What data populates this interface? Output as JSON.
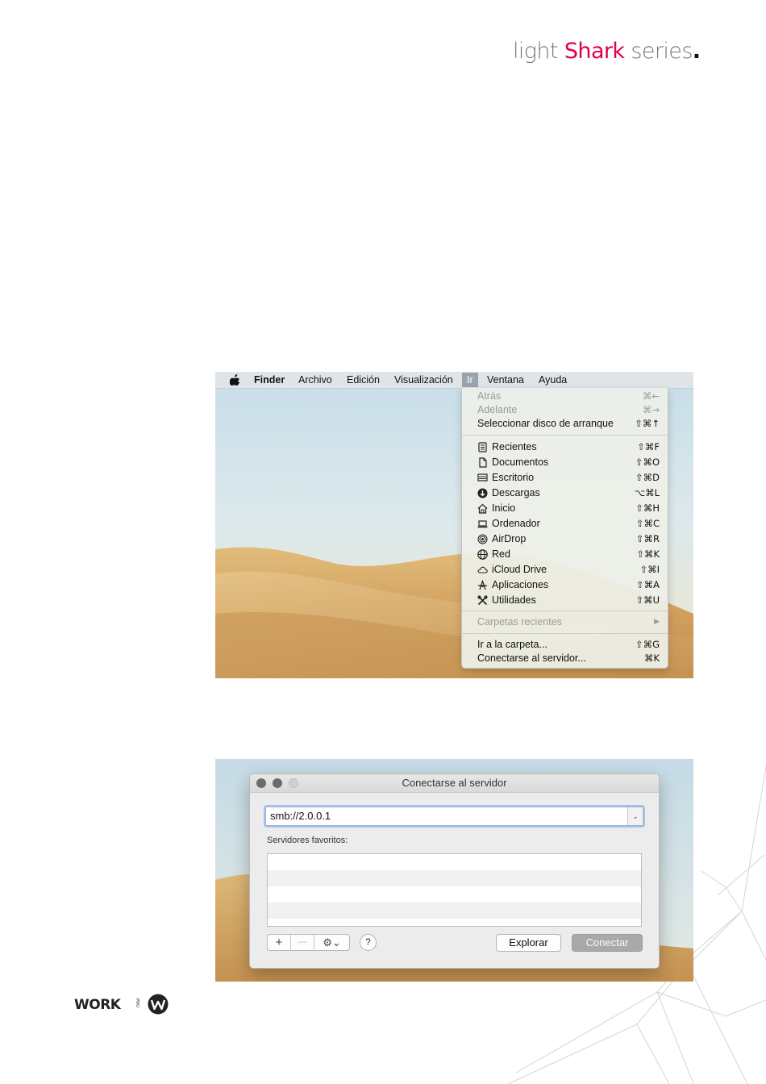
{
  "brand": {
    "light": "light",
    "shark": "Shark",
    "series": "series",
    "dot": ".",
    "shark_color": "#e0004d"
  },
  "menubar": {
    "apple_icon": "apple-icon",
    "items": [
      "Finder",
      "Archivo",
      "Edición",
      "Visualización",
      "Ir",
      "Ventana",
      "Ayuda"
    ],
    "active": "Ir"
  },
  "go_menu": {
    "atras": {
      "label": "Atrás",
      "shortcut": "⌘←"
    },
    "adelante": {
      "label": "Adelante",
      "shortcut": "⌘→"
    },
    "arranque": {
      "label": "Seleccionar disco de arranque",
      "shortcut": "⇧⌘↑"
    },
    "places": [
      {
        "label": "Recientes",
        "shortcut": "⇧⌘F",
        "icon": "recents-icon"
      },
      {
        "label": "Documentos",
        "shortcut": "⇧⌘O",
        "icon": "documents-icon"
      },
      {
        "label": "Escritorio",
        "shortcut": "⇧⌘D",
        "icon": "desktop-icon"
      },
      {
        "label": "Descargas",
        "shortcut": "⌥⌘L",
        "icon": "downloads-icon"
      },
      {
        "label": "Inicio",
        "shortcut": "⇧⌘H",
        "icon": "home-icon"
      },
      {
        "label": "Ordenador",
        "shortcut": "⇧⌘C",
        "icon": "computer-icon"
      },
      {
        "label": "AirDrop",
        "shortcut": "⇧⌘R",
        "icon": "airdrop-icon"
      },
      {
        "label": "Red",
        "shortcut": "⇧⌘K",
        "icon": "network-icon"
      },
      {
        "label": "iCloud Drive",
        "shortcut": "⇧⌘I",
        "icon": "icloud-icon"
      },
      {
        "label": "Aplicaciones",
        "shortcut": "⇧⌘A",
        "icon": "applications-icon"
      },
      {
        "label": "Utilidades",
        "shortcut": "⇧⌘U",
        "icon": "utilities-icon"
      }
    ],
    "recent_folders": {
      "label": "Carpetas recientes",
      "arrow": "▶"
    },
    "go_to_folder": {
      "label": "Ir a la carpeta...",
      "shortcut": "⇧⌘G"
    },
    "connect_server": {
      "label": "Conectarse al servidor...",
      "shortcut": "⌘K"
    }
  },
  "dialog": {
    "title": "Conectarse al servidor",
    "url_value": "smb://2.0.0.1",
    "favorites_label": "Servidores favoritos:",
    "add_symbol": "+",
    "remove_symbol": "—",
    "gear_symbol": "⚙⌄",
    "help_symbol": "?",
    "explore_label": "Explorar",
    "connect_label": "Conectar"
  },
  "footer": {
    "logo_text": "WORK",
    "logo_small": "PRO"
  }
}
